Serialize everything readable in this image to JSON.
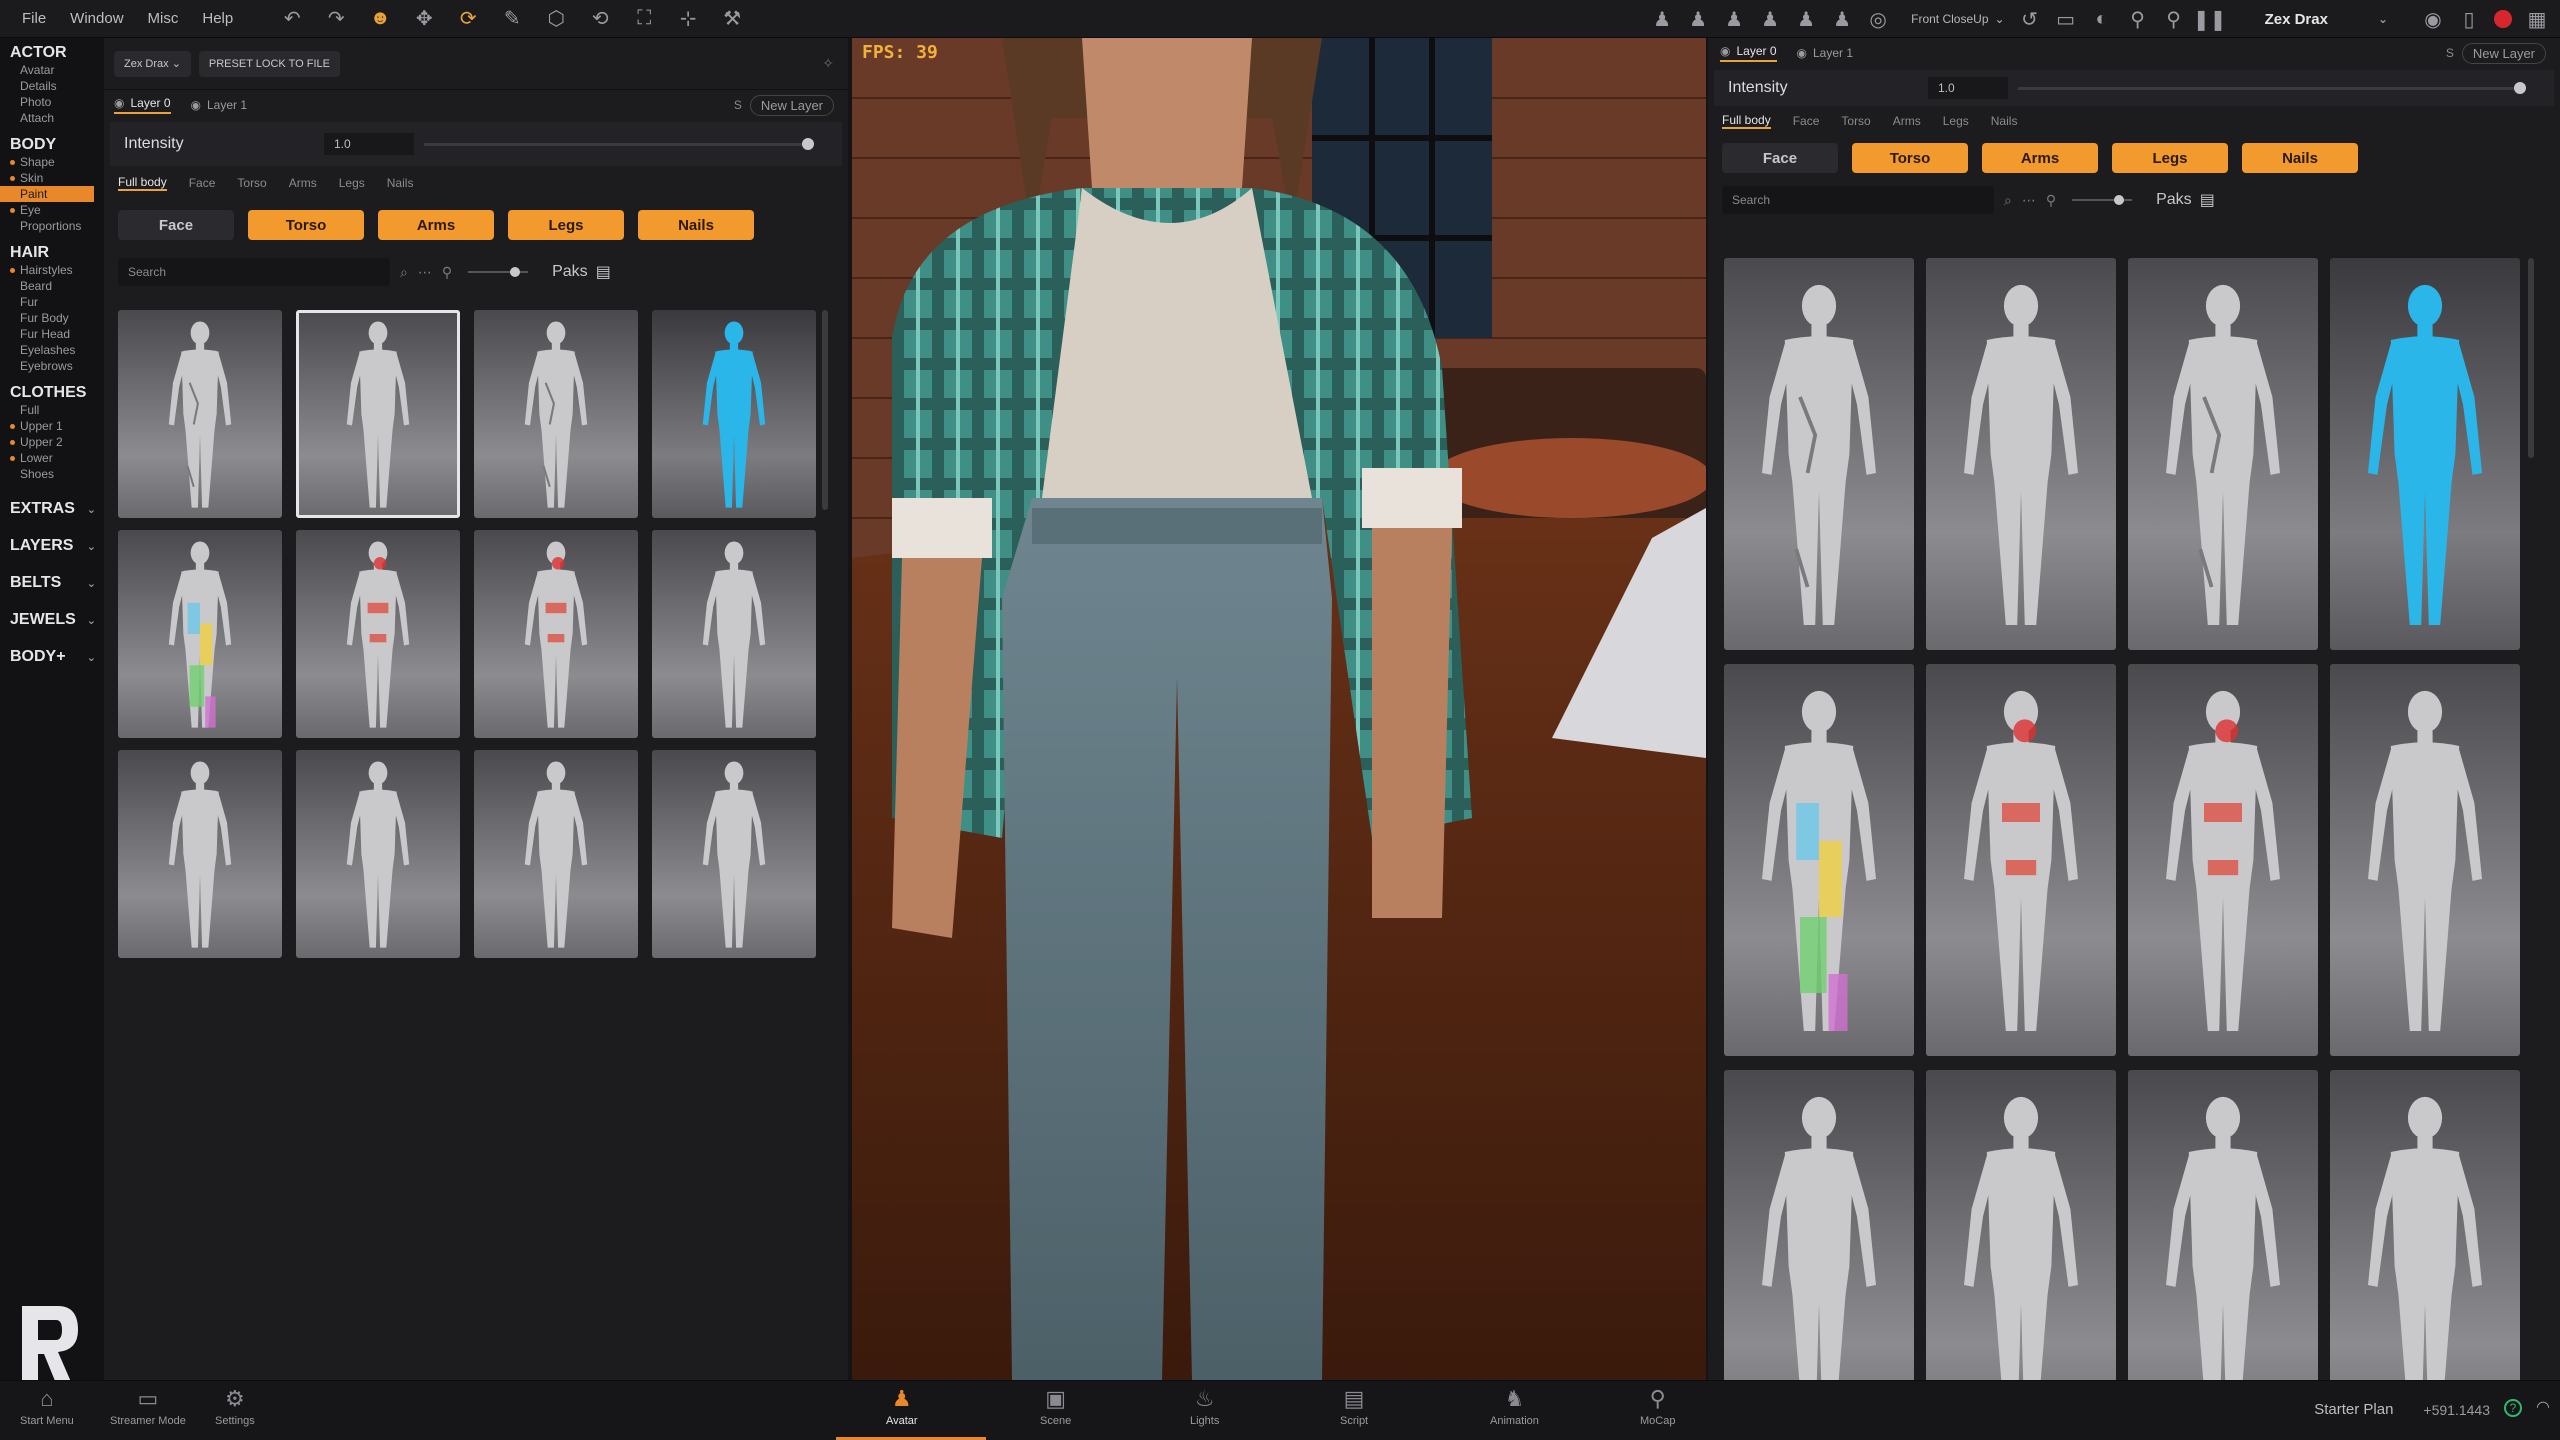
{
  "menu": [
    "File",
    "Window",
    "Misc",
    "Help"
  ],
  "toolbar": {
    "camera": "Front CloseUp",
    "user": "Zex Drax"
  },
  "sidebar": {
    "sections": [
      {
        "title": "ACTOR",
        "items": [
          {
            "label": "Avatar"
          },
          {
            "label": "Details"
          },
          {
            "label": "Photo"
          },
          {
            "label": "Attach"
          }
        ]
      },
      {
        "title": "BODY",
        "items": [
          {
            "label": "Shape",
            "dot": true
          },
          {
            "label": "Skin",
            "dot": true
          },
          {
            "label": "Paint",
            "active": true
          },
          {
            "label": "Eye",
            "dot": true
          },
          {
            "label": "Proportions"
          }
        ]
      },
      {
        "title": "HAIR",
        "items": [
          {
            "label": "Hairstyles",
            "dot": true
          },
          {
            "label": "Beard"
          },
          {
            "label": "Fur"
          },
          {
            "label": "Fur Body"
          },
          {
            "label": "Fur Head"
          },
          {
            "label": "Eyelashes"
          },
          {
            "label": "Eyebrows"
          }
        ]
      },
      {
        "title": "CLOTHES",
        "items": [
          {
            "label": "Full"
          },
          {
            "label": "Upper 1",
            "dot": true
          },
          {
            "label": "Upper 2",
            "dot": true
          },
          {
            "label": "Lower",
            "dot": true
          },
          {
            "label": "Shoes"
          }
        ]
      }
    ],
    "collapsed": [
      "EXTRAS",
      "LAYERS",
      "BELTS",
      "JEWELS",
      "BODY+"
    ]
  },
  "left_panel": {
    "actor_chip": "Zex Drax",
    "preset_button": "PRESET LOCK TO FILE",
    "layers": [
      "Layer 0",
      "Layer 1"
    ],
    "new_layer_hint": "S",
    "new_layer": "New Layer",
    "intensity_label": "Intensity",
    "intensity_value": "1.0",
    "intensity_level": 1.0,
    "subtabs": [
      "Full body",
      "Face",
      "Torso",
      "Arms",
      "Legs",
      "Nails"
    ],
    "categories": [
      {
        "label": "Face",
        "on": false
      },
      {
        "label": "Torso",
        "on": true
      },
      {
        "label": "Arms",
        "on": true
      },
      {
        "label": "Legs",
        "on": true
      },
      {
        "label": "Nails",
        "on": true
      }
    ],
    "search_placeholder": "Search",
    "paks_label": "Paks"
  },
  "viewport": {
    "fps": "FPS: 39"
  },
  "right_panel": {
    "layers": [
      "Layer 0",
      "Layer 1"
    ],
    "new_layer_hint": "S",
    "new_layer": "New Layer",
    "intensity_label": "Intensity",
    "intensity_value": "1.0",
    "subtabs": [
      "Full body",
      "Face",
      "Torso",
      "Arms",
      "Legs",
      "Nails"
    ],
    "categories": [
      {
        "label": "Face",
        "on": false
      },
      {
        "label": "Torso",
        "on": true
      },
      {
        "label": "Arms",
        "on": true
      },
      {
        "label": "Legs",
        "on": true
      },
      {
        "label": "Nails",
        "on": true
      }
    ],
    "search_placeholder": "Search",
    "paks_label": "Paks"
  },
  "tiles": [
    {
      "variant": "tattoo-gray"
    },
    {
      "variant": "plain-gray",
      "selected": true
    },
    {
      "variant": "tattoo-gray"
    },
    {
      "variant": "blue"
    },
    {
      "variant": "colorful"
    },
    {
      "variant": "red-paint"
    },
    {
      "variant": "red-paint"
    },
    {
      "variant": "plain-gray"
    },
    {
      "variant": "plain-gray"
    },
    {
      "variant": "plain-gray"
    },
    {
      "variant": "plain-gray"
    },
    {
      "variant": "plain-gray"
    }
  ],
  "bottom_bar": {
    "left": [
      {
        "label": "Start Menu",
        "icon": "home-icon"
      },
      {
        "label": "Streamer Mode",
        "icon": "monitor-icon"
      },
      {
        "label": "Settings",
        "icon": "gear-icon"
      }
    ],
    "tabs": [
      {
        "label": "Avatar",
        "icon": "avatar-icon",
        "active": true
      },
      {
        "label": "Scene",
        "icon": "scene-icon"
      },
      {
        "label": "Lights",
        "icon": "bulb-icon"
      },
      {
        "label": "Script",
        "icon": "script-icon"
      },
      {
        "label": "Animation",
        "icon": "animation-icon"
      },
      {
        "label": "MoCap",
        "icon": "mocap-icon"
      }
    ],
    "plan": "Starter Plan",
    "credits": "+591.1443"
  },
  "colors": {
    "accent": "#f29a2e",
    "accent_dark": "#e9882b",
    "fps": "#f2b23a",
    "blue_skin": "#2ab6e8",
    "red_dot": "#d8262f"
  }
}
